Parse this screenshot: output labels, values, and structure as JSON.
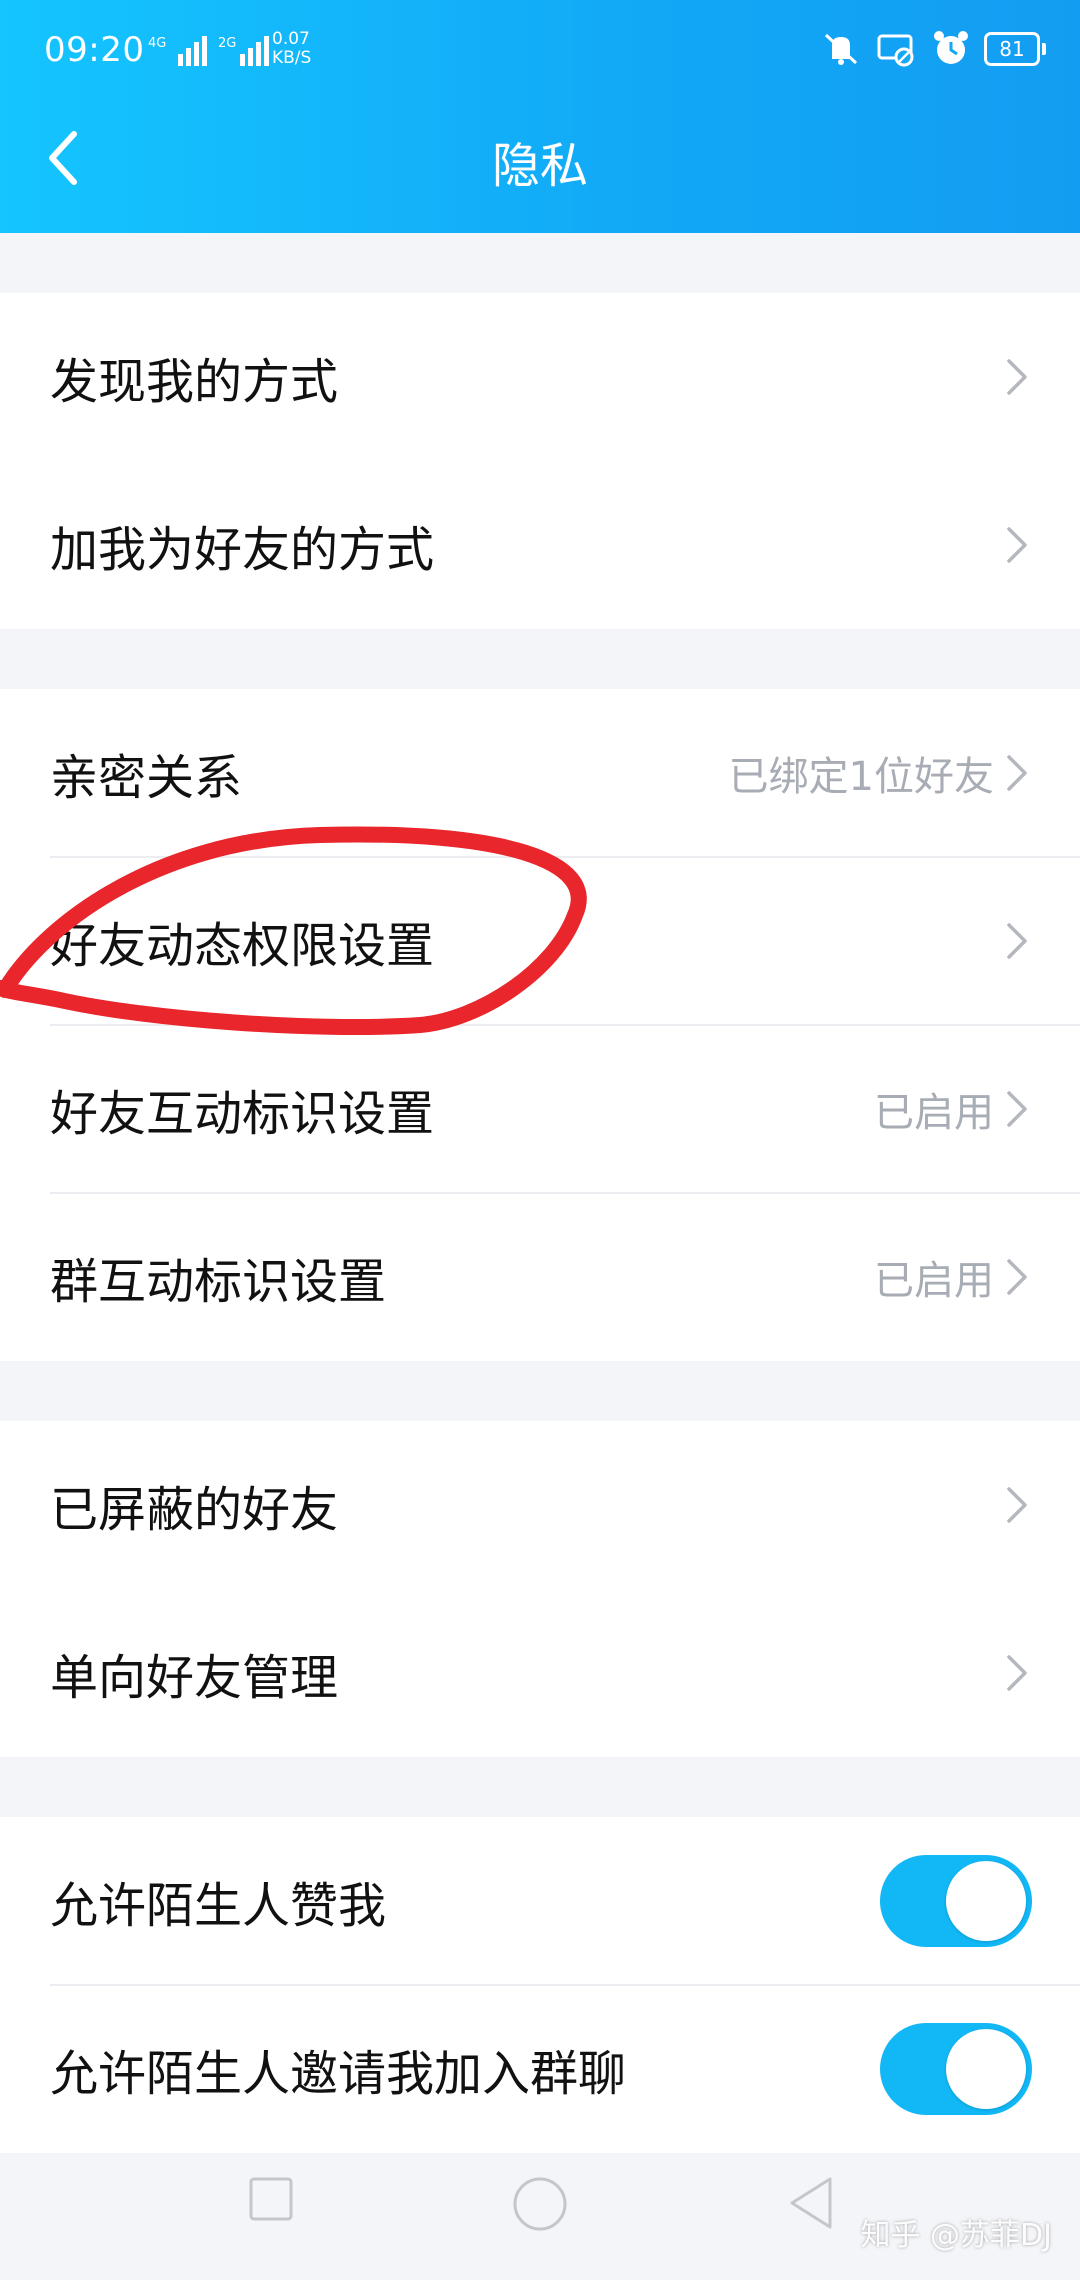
{
  "status_bar": {
    "time": "09:20",
    "network_1": "4G",
    "network_2": "2G",
    "speed_value": "0.07",
    "speed_unit": "KB/S",
    "battery": "81"
  },
  "header": {
    "title": "隐私",
    "back_icon": "back-arrow-icon"
  },
  "sections": [
    {
      "items": [
        {
          "label": "发现我的方式",
          "value": ""
        },
        {
          "label": "加我为好友的方式",
          "value": ""
        }
      ]
    },
    {
      "items": [
        {
          "label": "亲密关系",
          "value": "已绑定1位好友"
        },
        {
          "label": "好友动态权限设置",
          "value": ""
        },
        {
          "label": "好友互动标识设置",
          "value": "已启用"
        },
        {
          "label": "群互动标识设置",
          "value": "已启用"
        }
      ]
    },
    {
      "items": [
        {
          "label": "已屏蔽的好友",
          "value": ""
        },
        {
          "label": "单向好友管理",
          "value": ""
        }
      ]
    },
    {
      "toggles": [
        {
          "label": "允许陌生人赞我",
          "on": true
        },
        {
          "label": "允许陌生人邀请我加入群聊",
          "on": true
        }
      ]
    }
  ],
  "watermark": "知乎 @苏菲DJ",
  "colors": {
    "header_start": "#14c5ff",
    "header_end": "#139df2",
    "toggle_on": "#12b7f5",
    "annotation": "#e8262b"
  }
}
